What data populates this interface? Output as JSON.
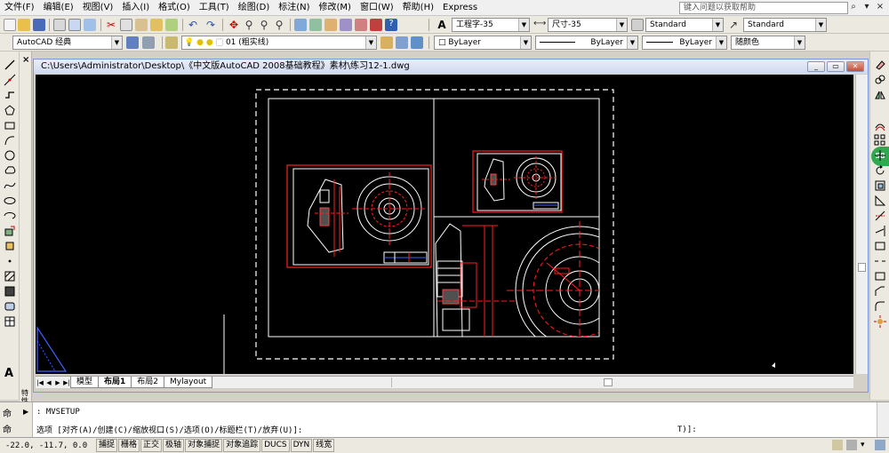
{
  "menubar": {
    "items": [
      "文件(F)",
      "编辑(E)",
      "视图(V)",
      "插入(I)",
      "格式(O)",
      "工具(T)",
      "绘图(D)",
      "标注(N)",
      "修改(M)",
      "窗口(W)",
      "帮助(H)",
      "Express"
    ],
    "help_search_placeholder": "键入问题以获取帮助"
  },
  "toolbar1": {
    "text_style": "工程字-35",
    "dim_style": "尺寸-35",
    "table_style": "Standard",
    "multileader_style": "Standard"
  },
  "toolbar2": {
    "workspace": "AutoCAD 经典",
    "layer": "01 (粗实线)",
    "color": "ByLayer",
    "linetype": "ByLayer",
    "lineweight": "ByLayer",
    "plotstyle": "随颜色"
  },
  "drawing_window": {
    "title": "C:\\Users\\Administrator\\Desktop\\《中文版AutoCAD 2008基础教程》素材\\练习12-1.dwg",
    "tabs": [
      "模型",
      "布局1",
      "布局2",
      "Mylayout"
    ],
    "active_tab": "布局1"
  },
  "side_panel": {
    "close": "×",
    "label": "特性"
  },
  "command": {
    "prefix1": "命",
    "prefix2": "命",
    "line1": ": MVSETUP",
    "line2": "选项 [对齐(A)/创建(C)/缩放视口(S)/选项(O)/标题栏(T)/放弃(U)]:",
    "tail": "T)]:"
  },
  "statusbar": {
    "coords": "-22.0, -11.7, 0.0",
    "buttons": [
      "捕捉",
      "栅格",
      "正交",
      "极轴",
      "对象捕捉",
      "对象追踪",
      "DUCS",
      "DYN",
      "线宽"
    ]
  },
  "right_toolbar": {
    "badge": "58"
  },
  "left_toolbar": {
    "text_tool": "A"
  },
  "colors": {
    "canvas": "#000000",
    "drawing_line": "#ffffff",
    "viewport_line": "#ff2020",
    "toolbar_bg": "#ece9e1"
  }
}
